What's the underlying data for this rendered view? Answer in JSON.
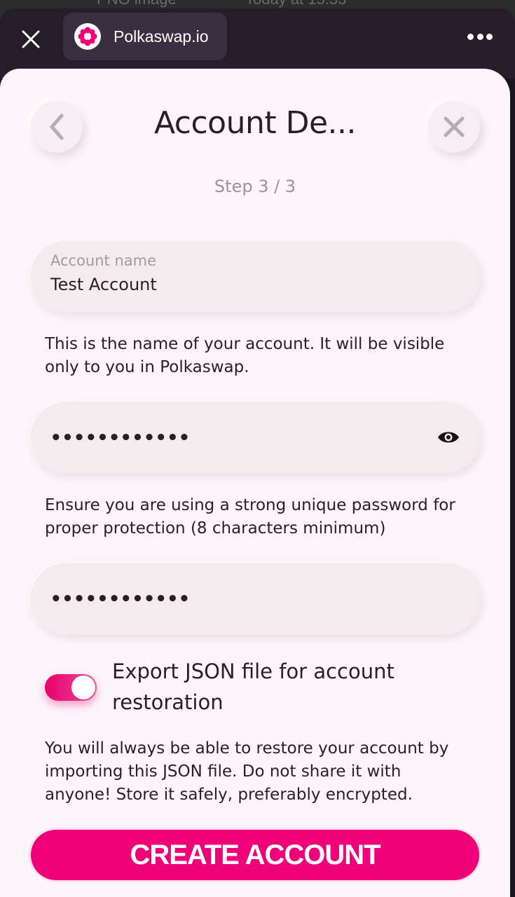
{
  "background": {
    "ghost_left": "PNG image",
    "ghost_right": "Today at 15:53"
  },
  "browser": {
    "site_name": "Polkaswap.io",
    "brand_color": "#ef0078"
  },
  "sheet": {
    "title": "Account De...",
    "step": "Step 3 / 3"
  },
  "account_name": {
    "label": "Account name",
    "value": "Test Account",
    "hint": "This is the name of your account. It will be visible only to you in Polkaswap."
  },
  "password": {
    "masked_value": "••••••••••••",
    "hint": "Ensure you are using a strong unique password for proper protection (8 characters minimum)"
  },
  "confirm_password": {
    "masked_value": "••••••••••••"
  },
  "export_json": {
    "label": "Export JSON file for account restoration",
    "enabled": true,
    "hint": "You will always be able to restore your account by importing this JSON file. Do not share it with anyone! Store it safely, preferably encrypted."
  },
  "create_button": {
    "label": "CREATE ACCOUNT"
  },
  "icons": {
    "close": "close-icon",
    "logo": "polkaswap-logo-icon",
    "more": "more-icon",
    "back": "chevron-left-icon",
    "dismiss": "close-icon",
    "eye": "eye-icon"
  }
}
